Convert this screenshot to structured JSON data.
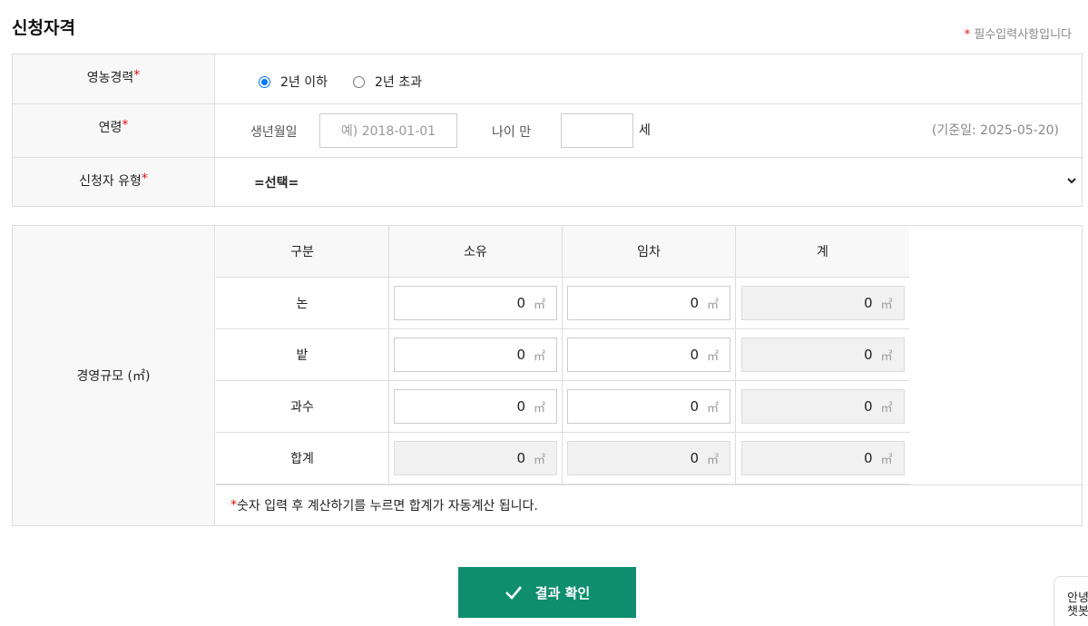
{
  "title": "신청자격",
  "required_note": "필수입력사항입니다",
  "required_mark": "*",
  "experience": {
    "label": "영농경력",
    "options": [
      "2년 이하",
      "2년 초과"
    ],
    "selected": "2년 이하"
  },
  "age": {
    "label": "연령",
    "birth_label": "생년월일",
    "birth_placeholder": "예) 2018-01-01",
    "age_label": "나이 만",
    "age_unit": "세",
    "base_date": "(기준일: 2025-05-20)"
  },
  "applicant_type": {
    "label": "신청자 유형",
    "selected": "=선택="
  },
  "scale": {
    "label": "경영규모 (㎡)",
    "headers": [
      "구분",
      "소유",
      "임차",
      "계"
    ],
    "unit": "㎡",
    "rows": [
      {
        "name": "논",
        "own": "0",
        "rent": "0",
        "total": "0"
      },
      {
        "name": "밭",
        "own": "0",
        "rent": "0",
        "total": "0"
      },
      {
        "name": "과수",
        "own": "0",
        "rent": "0",
        "total": "0"
      },
      {
        "name": "합계",
        "own": "0",
        "rent": "0",
        "total": "0"
      }
    ],
    "note": "숫자 입력 후 계산하기를 누르면 합계가 자동계산 됩니다."
  },
  "confirm_button": "결과 확인",
  "chatbot": {
    "line1": "안녕",
    "line2": "챗봇"
  },
  "colors": {
    "accent": "#0e8e6e",
    "required": "#dd1111",
    "radio": "#0075ff"
  }
}
